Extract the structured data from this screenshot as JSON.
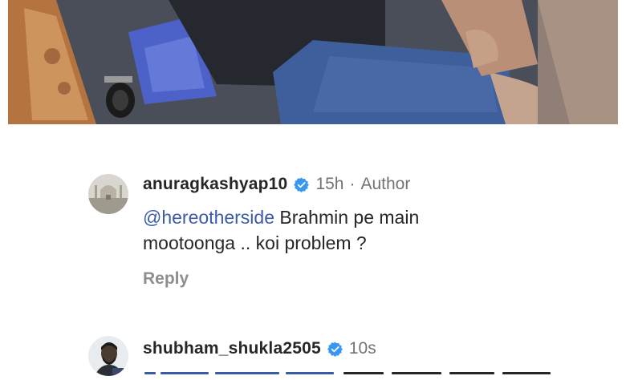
{
  "photo": {
    "description_icon": "post-photo"
  },
  "comments": [
    {
      "username": "anuragkashyap10",
      "verified": true,
      "time": "15h",
      "separator": "·",
      "author_label": "Author",
      "mention": "@hereotherside",
      "text_line1": " Brahmin pe main",
      "text_line2": "mootoonga .. koi problem ?",
      "reply_label": "Reply"
    },
    {
      "username": "shubham_shukla2505",
      "verified": true,
      "time": "10s"
    }
  ],
  "colors": {
    "mention": "#3b5ba8",
    "verified": "#3897f0",
    "secondary_text": "#737373"
  }
}
